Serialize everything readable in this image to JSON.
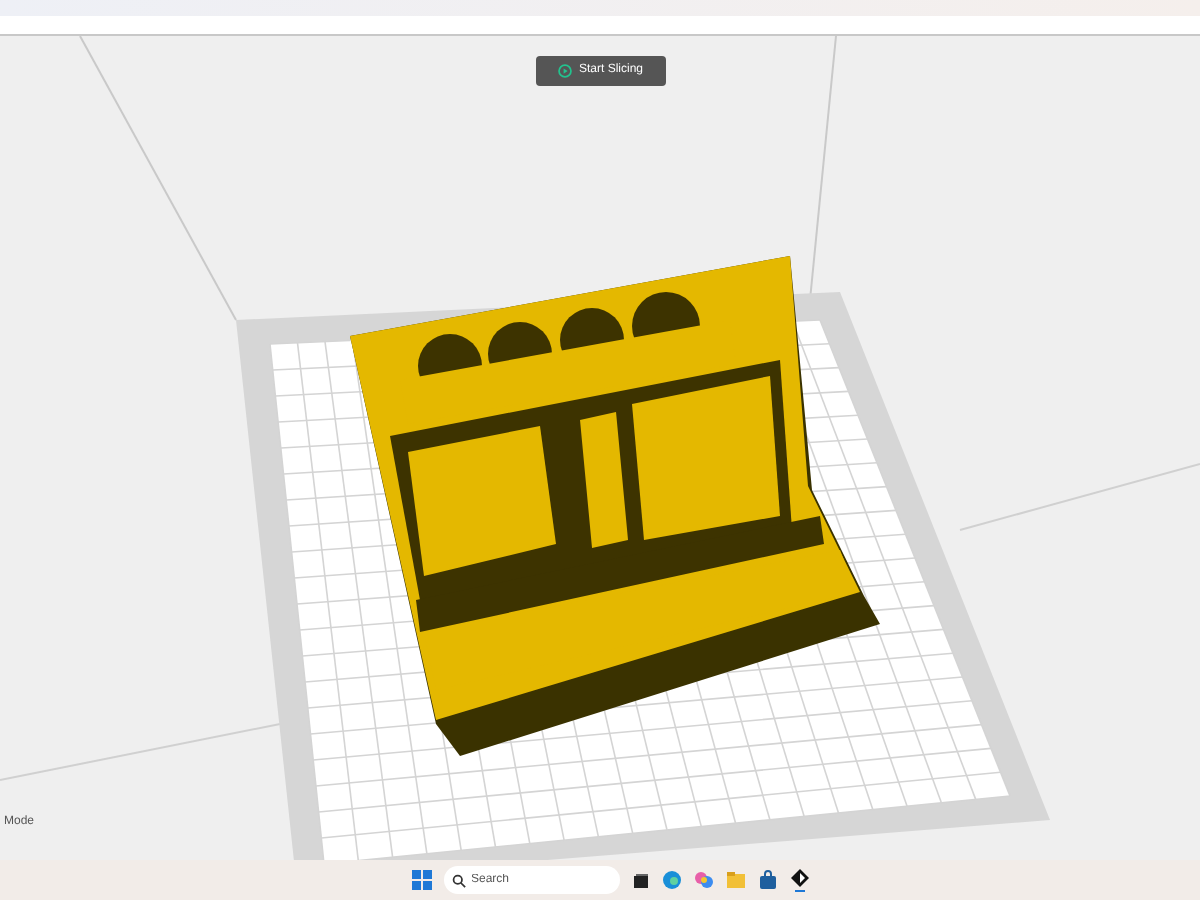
{
  "toolbar": {
    "slice_button": "Start Slicing"
  },
  "viewport": {
    "mode_label": "Mode"
  },
  "taskbar": {
    "search": {
      "placeholder": "Search"
    }
  }
}
